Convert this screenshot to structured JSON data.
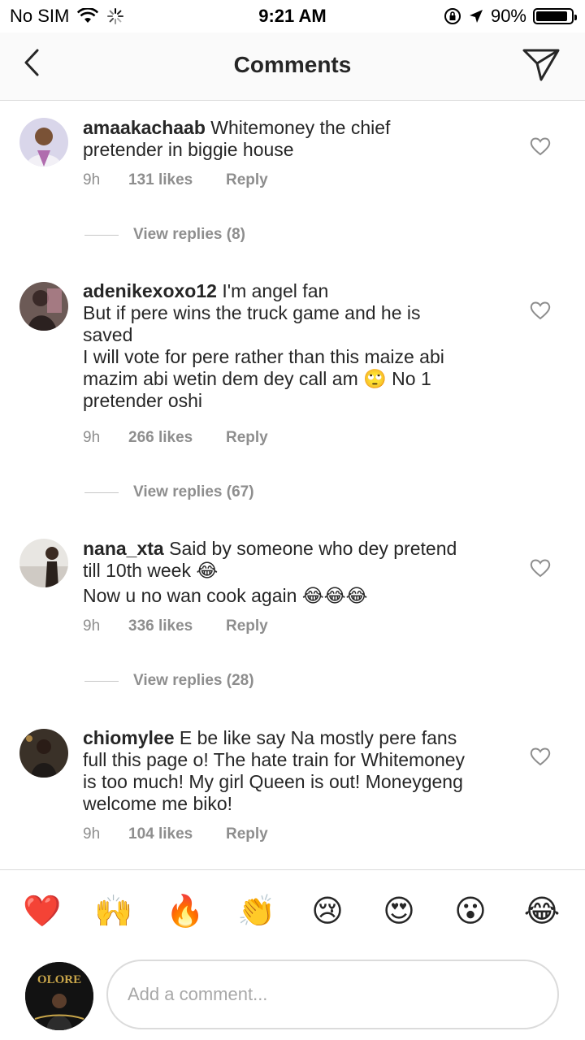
{
  "status": {
    "carrier": "No SIM",
    "time": "9:21 AM",
    "battery": "90%",
    "battery_level": 0.9
  },
  "nav": {
    "title": "Comments"
  },
  "comments": [
    {
      "username": "amaakachaab",
      "lines": [
        "Whitemoney the chief",
        "pretender in biggie house"
      ],
      "time": "9h",
      "likes": "131 likes",
      "reply": "Reply",
      "view_replies": "View replies (8)"
    },
    {
      "username": "adenikexoxo12",
      "lines": [
        "I'm angel fan",
        "But if pere wins the truck game and he is",
        "saved",
        "I will vote for pere rather than this maize abi",
        "mazim abi wetin dem dey call am 🙄 No 1",
        "pretender oshi"
      ],
      "time": "9h",
      "likes": "266 likes",
      "reply": "Reply",
      "view_replies": "View replies (67)"
    },
    {
      "username": "nana_xta",
      "lines": [
        "Said by someone who dey pretend",
        "till 10th week 😂",
        "Now u no wan cook again 😂😂😂"
      ],
      "time": "9h",
      "likes": "336 likes",
      "reply": "Reply",
      "view_replies": "View replies (28)"
    },
    {
      "username": "chiomylee",
      "lines": [
        "E be like say Na mostly pere fans",
        "full this page o! The hate train for Whitemoney",
        "is too much! My girl Queen is out! Moneygeng",
        "welcome me biko!"
      ],
      "time": "9h",
      "likes": "104 likes",
      "reply": "Reply",
      "view_replies": ""
    }
  ],
  "emojis": [
    "❤️",
    "🙌",
    "🔥",
    "👏",
    "😢",
    "😍",
    "😮",
    "😂"
  ],
  "composer": {
    "placeholder": "Add a comment...",
    "avatar_text": "OLORE"
  }
}
